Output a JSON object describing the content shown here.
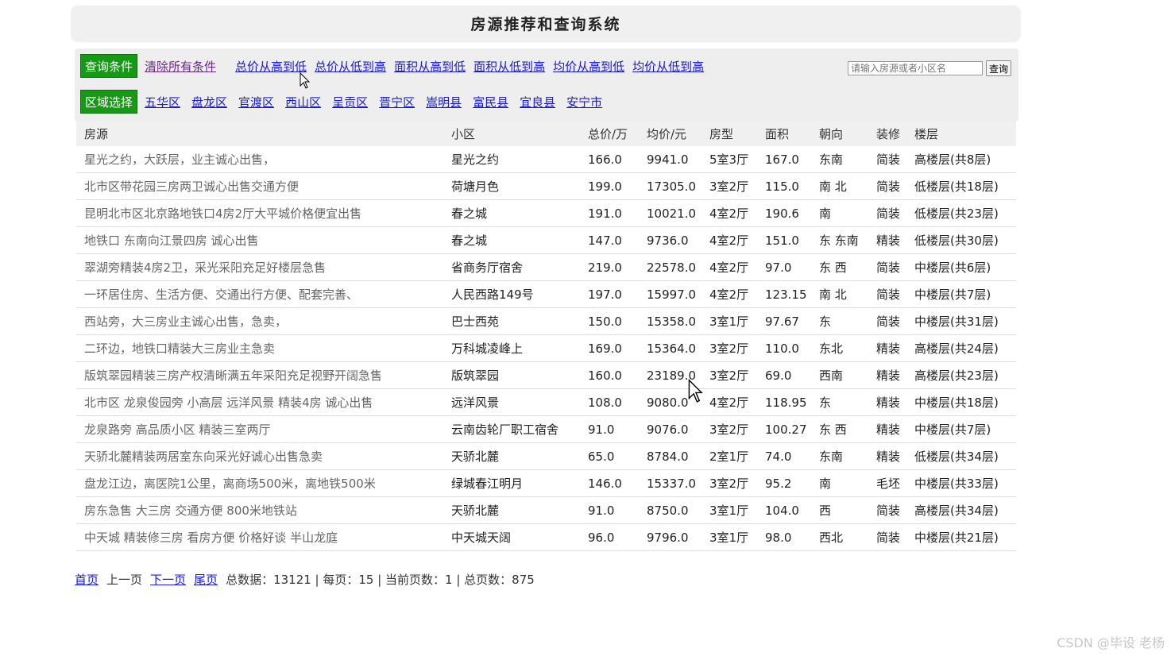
{
  "header": {
    "title": "房源推荐和查询系统"
  },
  "filters": {
    "query_tag": "查询条件",
    "clear_all": "清除所有条件",
    "sort_links": [
      "总价从高到低",
      "总价从低到高",
      "面积从高到低",
      "面积从低到高",
      "均价从高到低",
      "均价从低到高"
    ],
    "region_tag": "区域选择",
    "regions": [
      "五华区",
      "盘龙区",
      "官渡区",
      "西山区",
      "呈贡区",
      "晋宁区",
      "嵩明县",
      "富民县",
      "宜良县",
      "安宁市"
    ],
    "search_placeholder": "请输入房源或者小区名",
    "search_button": "查询"
  },
  "table": {
    "headers": [
      "房源",
      "小区",
      "总价/万",
      "均价/元",
      "房型",
      "面积",
      "朝向",
      "装修",
      "楼层"
    ],
    "rows": [
      [
        "星光之约，大跃层，业主诚心出售，",
        "星光之约",
        "166.0",
        "9941.0",
        "5室3厅",
        "167.0",
        "东南",
        "简装",
        "高楼层(共8层)"
      ],
      [
        "北市区带花园三房两卫诚心出售交通方便",
        "荷塘月色",
        "199.0",
        "17305.0",
        "3室2厅",
        "115.0",
        "南 北",
        "简装",
        "低楼层(共18层)"
      ],
      [
        "昆明北市区北京路地铁口4房2厅大平城价格便宜出售",
        "春之城",
        "191.0",
        "10021.0",
        "4室2厅",
        "190.6",
        "南",
        "简装",
        "低楼层(共23层)"
      ],
      [
        "地铁口 东南向江景四房 诚心出售",
        "春之城",
        "147.0",
        "9736.0",
        "4室2厅",
        "151.0",
        "东 东南",
        "精装",
        "低楼层(共30层)"
      ],
      [
        "翠湖旁精装4房2卫，采光采阳充足好楼层急售",
        "省商务厅宿舍",
        "219.0",
        "22578.0",
        "4室2厅",
        "97.0",
        "东 西",
        "简装",
        "中楼层(共6层)"
      ],
      [
        "一环居住房、生活方便、交通出行方便、配套完善、",
        "人民西路149号",
        "197.0",
        "15997.0",
        "4室2厅",
        "123.15",
        "南 北",
        "简装",
        "中楼层(共7层)"
      ],
      [
        "西站旁，大三房业主诚心出售，急卖，",
        "巴士西苑",
        "150.0",
        "15358.0",
        "3室1厅",
        "97.67",
        "东",
        "简装",
        "中楼层(共31层)"
      ],
      [
        "二环边，地铁口精装大三房业主急卖",
        "万科城凌峰上",
        "169.0",
        "15364.0",
        "3室2厅",
        "110.0",
        "东北",
        "精装",
        "高楼层(共24层)"
      ],
      [
        "版筑翠园精装三房产权清晰满五年采阳充足视野开阔急售",
        "版筑翠园",
        "160.0",
        "23189.0",
        "3室2厅",
        "69.0",
        "西南",
        "精装",
        "高楼层(共23层)"
      ],
      [
        "北市区 龙泉俊园旁 小高层 远洋风景 精装4房 诚心出售",
        "远洋风景",
        "108.0",
        "9080.0",
        "4室2厅",
        "118.95",
        "东",
        "精装",
        "中楼层(共18层)"
      ],
      [
        "龙泉路旁 高品质小区 精装三室两厅",
        "云南齿轮厂职工宿舍",
        "91.0",
        "9076.0",
        "3室2厅",
        "100.27",
        "东 西",
        "精装",
        "中楼层(共7层)"
      ],
      [
        "天骄北麓精装两居室东向采光好诚心出售急卖",
        "天骄北麓",
        "65.0",
        "8784.0",
        "2室1厅",
        "74.0",
        "东南",
        "精装",
        "低楼层(共34层)"
      ],
      [
        "盘龙江边，离医院1公里，离商场500米，离地铁500米",
        "绿城春江明月",
        "146.0",
        "15337.0",
        "3室2厅",
        "95.2",
        "南",
        "毛坯",
        "中楼层(共33层)"
      ],
      [
        "房东急售 大三房 交通方便 800米地铁站",
        "天骄北麓",
        "91.0",
        "8750.0",
        "3室1厅",
        "104.0",
        "西",
        "简装",
        "高楼层(共34层)"
      ],
      [
        "中天城 精装修三房 看房方便 价格好谈 半山龙庭",
        "中天城天阔",
        "96.0",
        "9796.0",
        "3室1厅",
        "98.0",
        "西北",
        "简装",
        "中楼层(共21层)"
      ]
    ]
  },
  "pagination": {
    "first": "首页",
    "prev": "上一页",
    "next": "下一页",
    "last": "尾页",
    "summary": "总数据：13121 | 每页：15 | 当前页数：1 | 总页数：875"
  },
  "watermark": "CSDN @毕设 老杨",
  "colors": {
    "tag_green": "#169a16",
    "link_blue": "#1a1ad4",
    "visited_purple": "#6a2a8a",
    "panel_gray": "#eeeeee"
  },
  "icons": {
    "cursor": "mouse-pointer-icon"
  }
}
